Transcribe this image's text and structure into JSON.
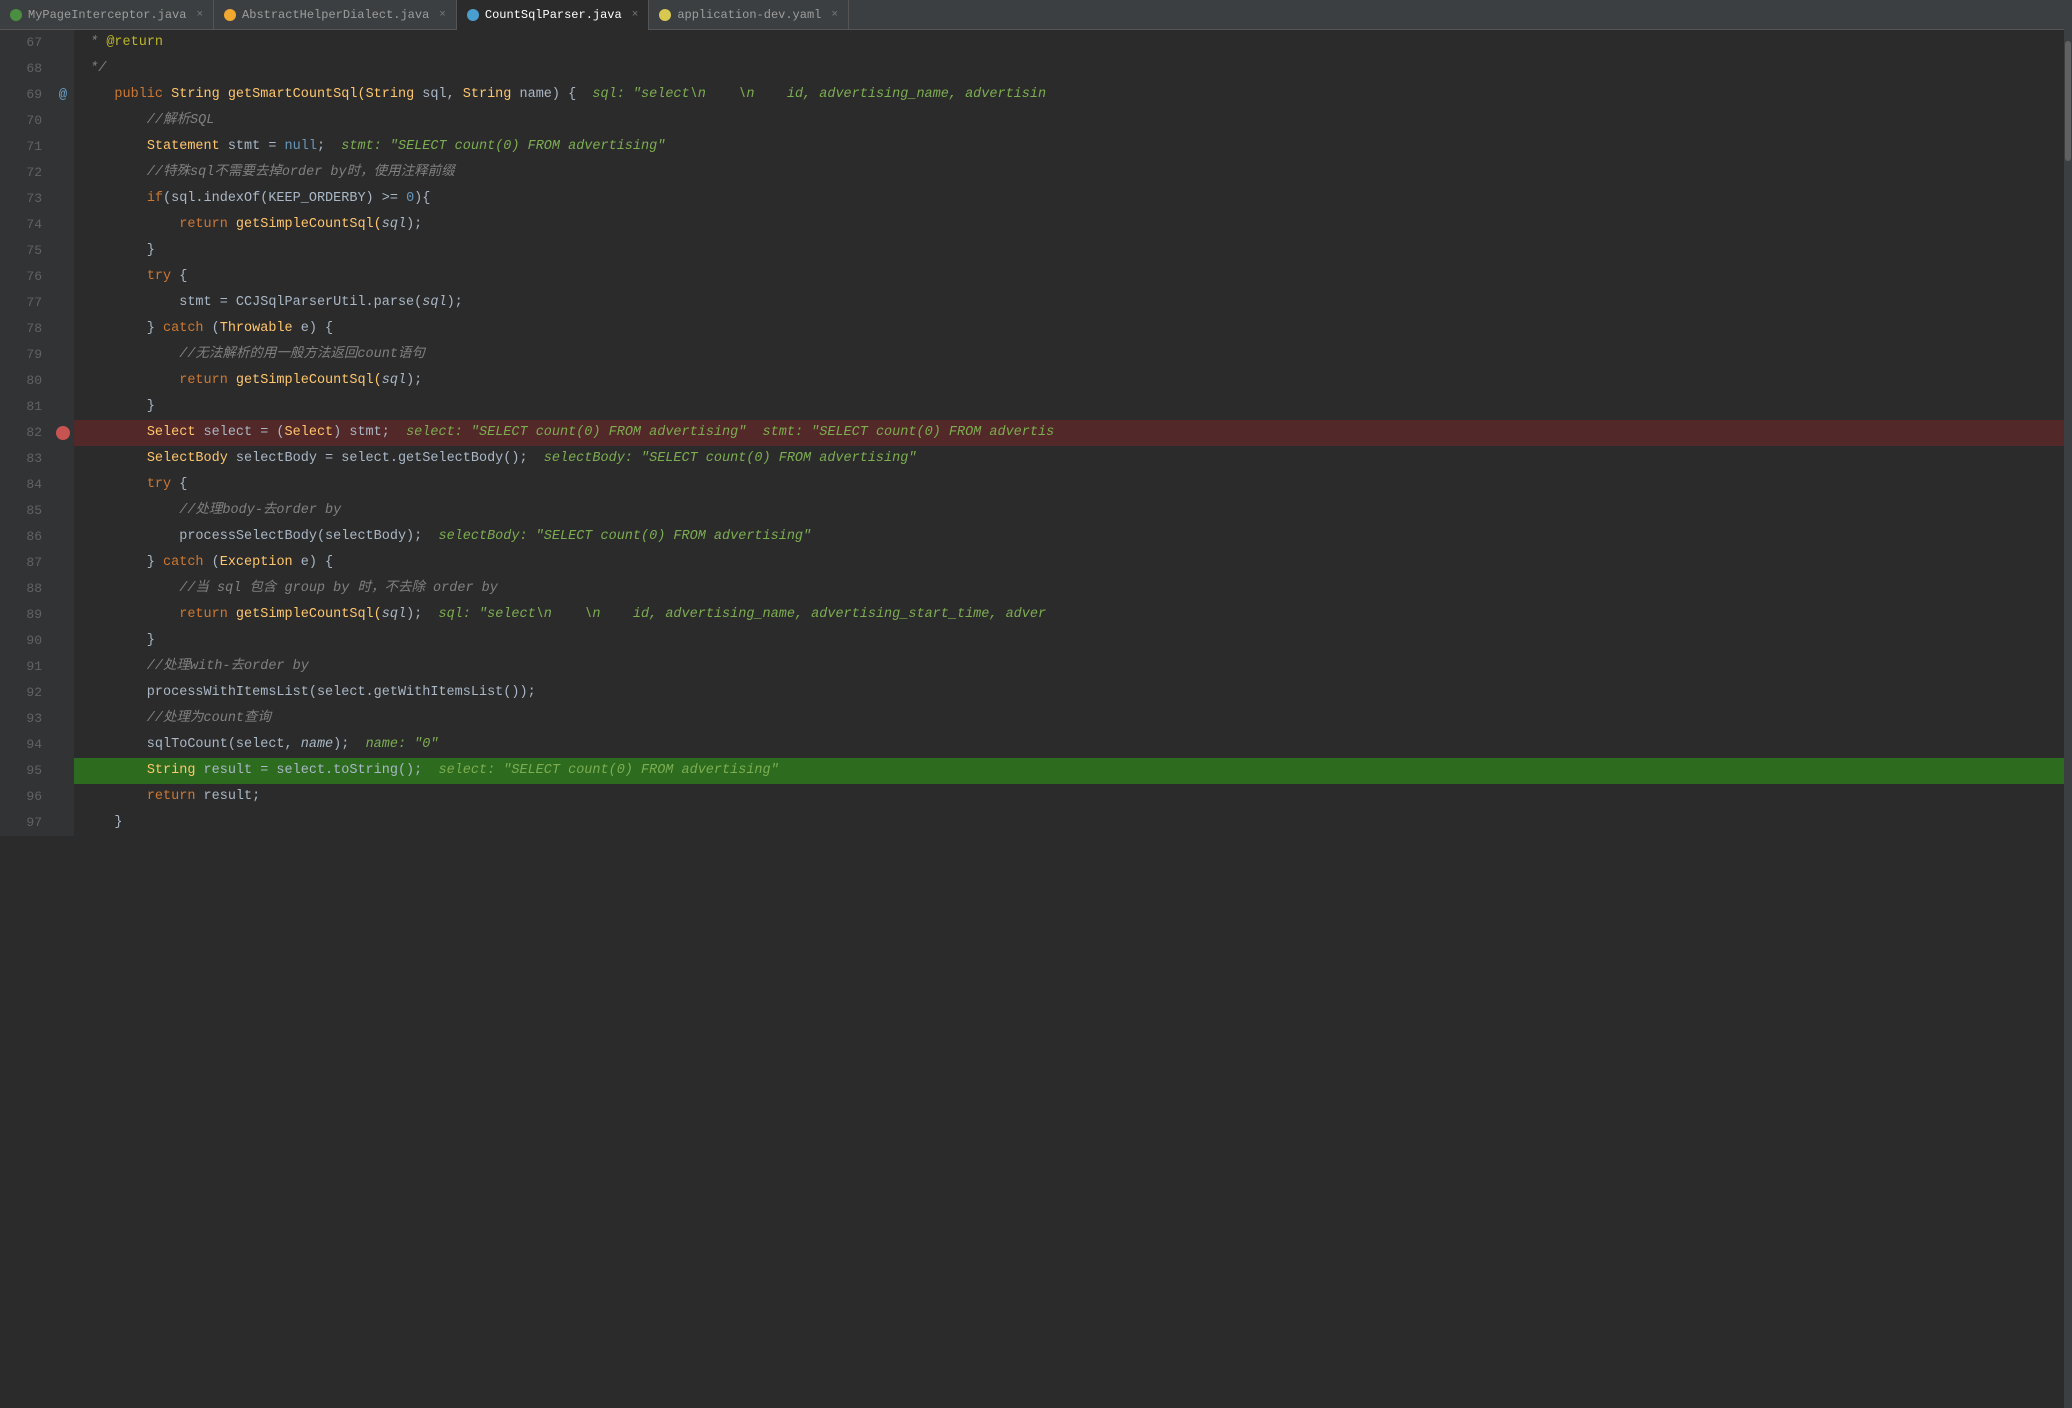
{
  "tabs": [
    {
      "id": "tab1",
      "icon": "green",
      "label": "MyPageInterceptor.java",
      "active": false,
      "modified": false
    },
    {
      "id": "tab2",
      "icon": "orange",
      "label": "AbstractHelperDialect.java",
      "active": false,
      "modified": false
    },
    {
      "id": "tab3",
      "icon": "blue",
      "label": "CountSqlParser.java",
      "active": true,
      "modified": false
    },
    {
      "id": "tab4",
      "icon": "yellow",
      "label": "application-dev.yaml",
      "active": false,
      "modified": false
    }
  ],
  "lines": [
    {
      "num": 67,
      "gutter": "",
      "indent": 2,
      "tokens": [
        {
          "t": " * ",
          "c": "cmt"
        },
        {
          "t": "@return",
          "c": "annot"
        }
      ]
    },
    {
      "num": 68,
      "gutter": "",
      "indent": 2,
      "tokens": [
        {
          "t": " */",
          "c": "cmt"
        }
      ]
    },
    {
      "num": 69,
      "gutter": "@",
      "indent": 0,
      "tokens": [
        {
          "t": "    public ",
          "c": "kw"
        },
        {
          "t": "String",
          "c": "cls"
        },
        {
          "t": " getSmartCountSql(",
          "c": "fn"
        },
        {
          "t": "String",
          "c": "cls"
        },
        {
          "t": " sql, ",
          "c": "var"
        },
        {
          "t": "String",
          "c": "cls"
        },
        {
          "t": " name) {",
          "c": "var"
        },
        {
          "t": "  sql: \"select\\n    \\n    id, advertising_name, advertisin",
          "c": "dbg-val"
        }
      ]
    },
    {
      "num": 70,
      "gutter": "",
      "indent": 0,
      "tokens": [
        {
          "t": "        //解析SQL",
          "c": "cmt"
        }
      ]
    },
    {
      "num": 71,
      "gutter": "",
      "indent": 0,
      "tokens": [
        {
          "t": "        ",
          "c": "var"
        },
        {
          "t": "Statement",
          "c": "cls"
        },
        {
          "t": " stmt = ",
          "c": "var"
        },
        {
          "t": "null",
          "c": "kw-blue"
        },
        {
          "t": ";  ",
          "c": "var"
        },
        {
          "t": "stmt: \"SELECT count(0) FROM advertising\"",
          "c": "dbg-val"
        }
      ]
    },
    {
      "num": 72,
      "gutter": "",
      "indent": 0,
      "tokens": [
        {
          "t": "        //特殊sql不需要去掉order by时，使用注释前缀",
          "c": "cmt"
        }
      ]
    },
    {
      "num": 73,
      "gutter": "",
      "indent": 0,
      "tokens": [
        {
          "t": "        ",
          "c": "var"
        },
        {
          "t": "if",
          "c": "kw"
        },
        {
          "t": "(sql.indexOf(KEEP_ORDERBY) >= ",
          "c": "var"
        },
        {
          "t": "0",
          "c": "num"
        },
        {
          "t": "){",
          "c": "var"
        }
      ]
    },
    {
      "num": 74,
      "gutter": "",
      "indent": 0,
      "tokens": [
        {
          "t": "            ",
          "c": "var"
        },
        {
          "t": "return",
          "c": "kw"
        },
        {
          "t": " getSimpleCountSql(",
          "c": "fn"
        },
        {
          "t": "sql",
          "c": "param"
        },
        {
          "t": ");",
          "c": "var"
        }
      ]
    },
    {
      "num": 75,
      "gutter": "",
      "indent": 0,
      "tokens": [
        {
          "t": "        }",
          "c": "var"
        }
      ]
    },
    {
      "num": 76,
      "gutter": "",
      "indent": 0,
      "tokens": [
        {
          "t": "        ",
          "c": "var"
        },
        {
          "t": "try",
          "c": "kw"
        },
        {
          "t": " {",
          "c": "var"
        }
      ]
    },
    {
      "num": 77,
      "gutter": "",
      "indent": 0,
      "tokens": [
        {
          "t": "            stmt = CCJSqlParserUtil.parse(",
          "c": "var"
        },
        {
          "t": "sql",
          "c": "param"
        },
        {
          "t": ");",
          "c": "var"
        }
      ]
    },
    {
      "num": 78,
      "gutter": "",
      "indent": 0,
      "tokens": [
        {
          "t": "        } ",
          "c": "var"
        },
        {
          "t": "catch",
          "c": "kw"
        },
        {
          "t": " (",
          "c": "var"
        },
        {
          "t": "Throwable",
          "c": "cls"
        },
        {
          "t": " e) {",
          "c": "var"
        }
      ]
    },
    {
      "num": 79,
      "gutter": "",
      "indent": 0,
      "tokens": [
        {
          "t": "            //无法解析的用一般方法返回count语句",
          "c": "cmt"
        }
      ]
    },
    {
      "num": 80,
      "gutter": "",
      "indent": 0,
      "tokens": [
        {
          "t": "            ",
          "c": "var"
        },
        {
          "t": "return",
          "c": "kw"
        },
        {
          "t": " getSimpleCountSql(",
          "c": "fn"
        },
        {
          "t": "sql",
          "c": "param"
        },
        {
          "t": ");",
          "c": "var"
        }
      ]
    },
    {
      "num": 81,
      "gutter": "",
      "indent": 0,
      "tokens": [
        {
          "t": "        }",
          "c": "var"
        }
      ]
    },
    {
      "num": 82,
      "gutter": "bp",
      "indent": 0,
      "special": "error",
      "tokens": [
        {
          "t": "        ",
          "c": "var"
        },
        {
          "t": "Select",
          "c": "cls"
        },
        {
          "t": " select = (",
          "c": "var"
        },
        {
          "t": "Select",
          "c": "cls"
        },
        {
          "t": ") stmt;  ",
          "c": "var"
        },
        {
          "t": "select: \"SELECT count(0) FROM advertising\"  stmt: \"SELECT count(0) FROM advertis",
          "c": "dbg-val"
        }
      ]
    },
    {
      "num": 83,
      "gutter": "",
      "indent": 0,
      "tokens": [
        {
          "t": "        ",
          "c": "var"
        },
        {
          "t": "SelectBody",
          "c": "cls"
        },
        {
          "t": " selectBody = select.getSelectBody();  ",
          "c": "var"
        },
        {
          "t": "selectBody: \"SELECT count(0) FROM advertising\"",
          "c": "dbg-val"
        }
      ]
    },
    {
      "num": 84,
      "gutter": "",
      "indent": 0,
      "tokens": [
        {
          "t": "        ",
          "c": "var"
        },
        {
          "t": "try",
          "c": "kw"
        },
        {
          "t": " {",
          "c": "var"
        }
      ]
    },
    {
      "num": 85,
      "gutter": "",
      "indent": 0,
      "tokens": [
        {
          "t": "            //处理body-去order by",
          "c": "cmt"
        }
      ]
    },
    {
      "num": 86,
      "gutter": "",
      "indent": 0,
      "tokens": [
        {
          "t": "            processSelectBody(selectBody);  ",
          "c": "var"
        },
        {
          "t": "selectBody: \"SELECT count(0) FROM advertising\"",
          "c": "dbg-val"
        }
      ]
    },
    {
      "num": 87,
      "gutter": "",
      "indent": 0,
      "tokens": [
        {
          "t": "        } ",
          "c": "var"
        },
        {
          "t": "catch",
          "c": "kw"
        },
        {
          "t": " (",
          "c": "var"
        },
        {
          "t": "Exception",
          "c": "cls"
        },
        {
          "t": " e) {",
          "c": "var"
        }
      ]
    },
    {
      "num": 88,
      "gutter": "",
      "indent": 0,
      "tokens": [
        {
          "t": "            //当 sql 包含 group by 时，不去除 order by",
          "c": "cmt"
        }
      ]
    },
    {
      "num": 89,
      "gutter": "",
      "indent": 0,
      "tokens": [
        {
          "t": "            ",
          "c": "var"
        },
        {
          "t": "return",
          "c": "kw"
        },
        {
          "t": " getSimpleCountSql(",
          "c": "fn"
        },
        {
          "t": "sql",
          "c": "param"
        },
        {
          "t": ");  ",
          "c": "var"
        },
        {
          "t": "sql: \"select\\n    \\n    id, advertising_name, advertising_start_time, adver",
          "c": "dbg-val"
        }
      ]
    },
    {
      "num": 90,
      "gutter": "",
      "indent": 0,
      "tokens": [
        {
          "t": "        }",
          "c": "var"
        }
      ]
    },
    {
      "num": 91,
      "gutter": "",
      "indent": 0,
      "tokens": [
        {
          "t": "        //处理with-去order by",
          "c": "cmt"
        }
      ]
    },
    {
      "num": 92,
      "gutter": "",
      "indent": 0,
      "tokens": [
        {
          "t": "        processWithItemsList(select.getWithItemsList());",
          "c": "var"
        }
      ]
    },
    {
      "num": 93,
      "gutter": "",
      "indent": 0,
      "tokens": [
        {
          "t": "        //处理为count查询",
          "c": "cmt"
        }
      ]
    },
    {
      "num": 94,
      "gutter": "",
      "indent": 0,
      "tokens": [
        {
          "t": "        sqlToCount(select, ",
          "c": "var"
        },
        {
          "t": "name",
          "c": "param"
        },
        {
          "t": ");  ",
          "c": "var"
        },
        {
          "t": "name: \"0\"",
          "c": "dbg-val"
        }
      ]
    },
    {
      "num": 95,
      "gutter": "",
      "indent": 0,
      "special": "active",
      "tokens": [
        {
          "t": "        ",
          "c": "var"
        },
        {
          "t": "String",
          "c": "cls"
        },
        {
          "t": " result = select.toString();  ",
          "c": "var"
        },
        {
          "t": "select: \"SELECT count(0) FROM advertising\"",
          "c": "dbg-val"
        }
      ]
    },
    {
      "num": 96,
      "gutter": "",
      "indent": 0,
      "tokens": [
        {
          "t": "        ",
          "c": "var"
        },
        {
          "t": "return",
          "c": "kw"
        },
        {
          "t": " result;",
          "c": "var"
        }
      ]
    },
    {
      "num": 97,
      "gutter": "",
      "indent": 0,
      "tokens": [
        {
          "t": "    }",
          "c": "var"
        }
      ]
    }
  ]
}
